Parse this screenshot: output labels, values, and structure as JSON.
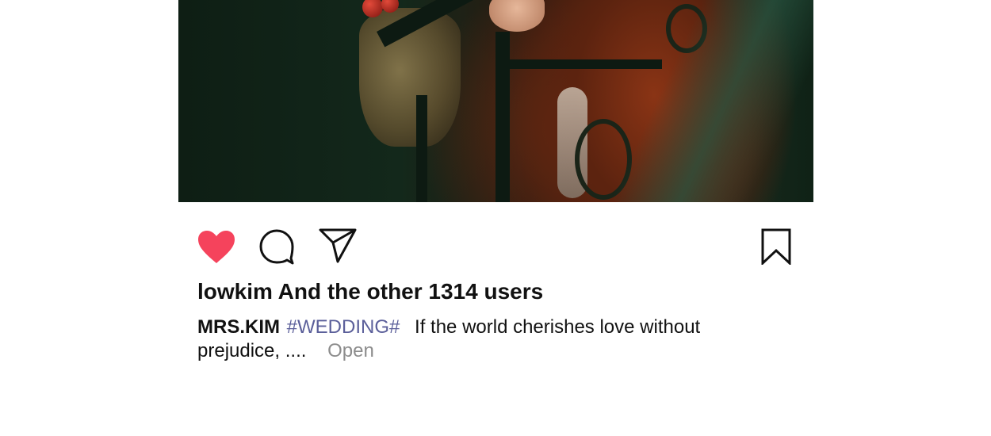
{
  "post": {
    "likes_text": "lowkim And the other 1314 users",
    "caption": {
      "author": "MRS.KIM",
      "hashtag": "#WEDDING#",
      "text": "If the world cherishes love without prejudice, ....",
      "more_label": "Open"
    },
    "actions": {
      "like": {
        "icon": "heart-icon",
        "active": true,
        "color": "#f5435c"
      },
      "comment": {
        "icon": "speech-bubble-icon"
      },
      "share": {
        "icon": "paper-plane-icon"
      },
      "save": {
        "icon": "bookmark-icon"
      }
    },
    "colors": {
      "text": "#111111",
      "hashtag": "#5b5f9a",
      "muted": "#8c8c8c",
      "heart": "#f5435c"
    }
  }
}
